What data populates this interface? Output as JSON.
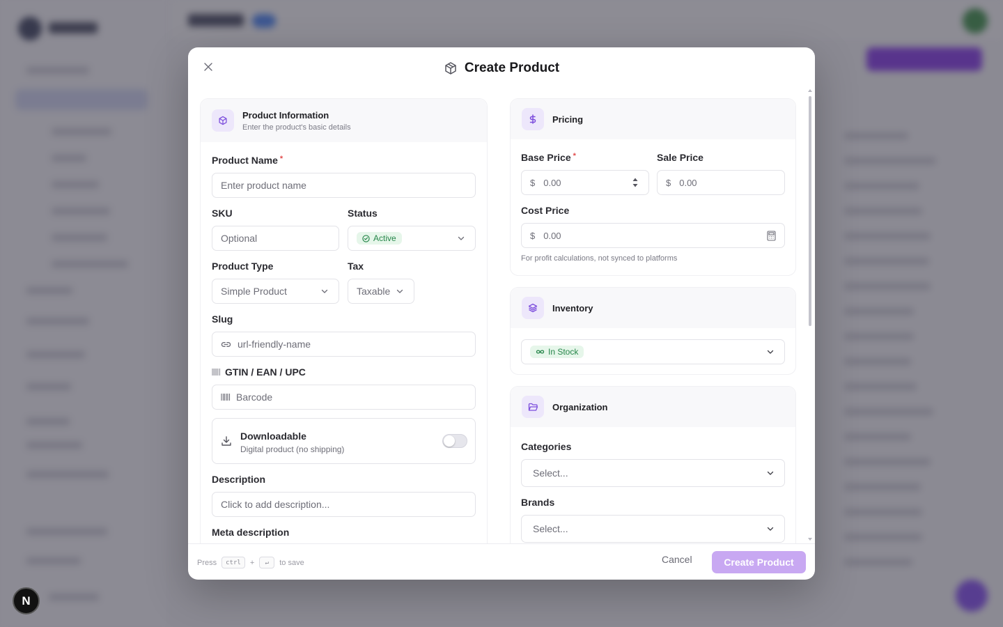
{
  "modal": {
    "title": "Create Product",
    "close_icon": "close-icon",
    "title_icon": "package-icon"
  },
  "product_info": {
    "title": "Product Information",
    "subtitle": "Enter the product's basic details",
    "icon": "package-icon",
    "product_name": {
      "label": "Product Name",
      "required_mark": "*",
      "placeholder": "Enter product name"
    },
    "sku": {
      "label": "SKU",
      "placeholder": "Optional"
    },
    "status": {
      "label": "Status",
      "value": "Active"
    },
    "product_type": {
      "label": "Product Type",
      "value": "Simple Product"
    },
    "tax": {
      "label": "Tax",
      "value": "Taxable"
    },
    "slug": {
      "label": "Slug",
      "placeholder": "url-friendly-name"
    },
    "gtin": {
      "label": "GTIN / EAN / UPC",
      "placeholder": "Barcode"
    },
    "downloadable": {
      "title": "Downloadable",
      "subtitle": "Digital product (no shipping)",
      "enabled": false
    },
    "description": {
      "label": "Description",
      "placeholder": "Click to add description..."
    },
    "meta_description": {
      "label": "Meta description"
    }
  },
  "pricing": {
    "title": "Pricing",
    "icon": "dollar-icon",
    "base_price": {
      "label": "Base Price",
      "required_mark": "*",
      "currency": "$",
      "placeholder": "0.00"
    },
    "sale_price": {
      "label": "Sale Price",
      "currency": "$",
      "placeholder": "0.00"
    },
    "cost_price": {
      "label": "Cost Price",
      "currency": "$",
      "placeholder": "0.00",
      "help": "For profit calculations, not synced to platforms"
    }
  },
  "inventory": {
    "title": "Inventory",
    "icon": "layers-icon",
    "stock_status": "In Stock"
  },
  "organization": {
    "title": "Organization",
    "icon": "folder-icon",
    "categories": {
      "label": "Categories",
      "placeholder": "Select..."
    },
    "brands": {
      "label": "Brands",
      "placeholder": "Select..."
    }
  },
  "footer": {
    "hint_press": "Press",
    "hint_key1": "ctrl",
    "hint_plus": "+",
    "hint_key2": "↵",
    "hint_suffix": "to save",
    "cancel_label": "Cancel",
    "create_label": "Create Product"
  },
  "colors": {
    "accent": "#7c4ddc",
    "primary_button_disabled": "#c8a8f2",
    "status_green_bg": "#e6f6ea",
    "status_green_text": "#26864a",
    "required": "#e14b4b"
  }
}
